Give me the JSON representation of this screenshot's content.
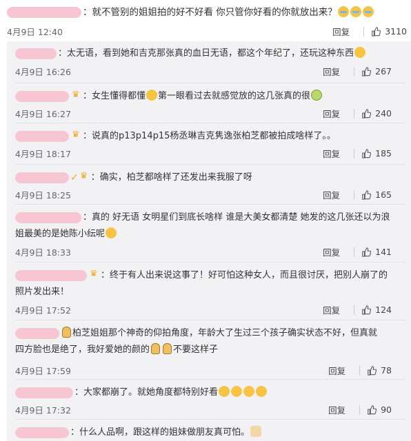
{
  "main": {
    "text": "：就不管别的姐姐拍的好不好看 你只管你好看的你就放出来？",
    "time": "4月9日 12:40",
    "reply": "回复",
    "likes": "3110"
  },
  "replies": [
    {
      "text": "：太无语，看到她和吉克那张真的血日无语，都这个年纪了，还玩这种东西",
      "time": "4月9日 16:26",
      "reply": "回复",
      "likes": "267"
    },
    {
      "text": "：女生懂得都懂",
      "text2": "第一眼看过去就感觉放的这几张真的很",
      "time": "4月9日 16:27",
      "reply": "回复",
      "likes": "240"
    },
    {
      "text": "：说真的p13p14p15杨丞琳吉克隽逸张柏芝都被拍成啥样了。。",
      "time": "4月9日 18:17",
      "reply": "回复",
      "likes": "185"
    },
    {
      "text": "：确实，柏芝都啥样了还发出来我服了呀",
      "time": "4月9日 18:25",
      "reply": "回复",
      "likes": "165"
    },
    {
      "text": "：真的 好无语 女明星们到底长啥样 谁是大美女都清楚 她发的这几张还以为浪",
      "text2": "姐最美的是她陈小纭呢",
      "time": "4月9日 18:33",
      "reply": "回复",
      "likes": "141"
    },
    {
      "text": "：终于有人出来说这事了！好可怕这种女人，而且很讨厌，把别人崩了的",
      "text2": "照片发出来！",
      "time": "4月9日 17:52",
      "reply": "回复",
      "likes": "124"
    },
    {
      "text": "柏芝姐姐那个神奇的仰拍角度，年龄大了生过三个孩子确实状态不好，但真就",
      "text2": "四方脸也是绝了，我好爱她的颜的",
      "text3": "不要这样子",
      "time": "4月9日 17:59",
      "reply": "回复",
      "likes": "78"
    },
    {
      "text": "：大家都崩了。就她角度都特别好看",
      "time": "4月9日 17:32",
      "reply": "回复",
      "likes": "90"
    },
    {
      "text": "：什么人品啊，跟这样的姐妹做朋友真可怕。"
    }
  ],
  "icons": {
    "like": "thumbs-up-icon",
    "verified": "vip-badge-icon"
  },
  "colors": {
    "name_pill": "#f7c6d3",
    "reply_bg": "#f2f2f5",
    "badge": "#f5a623"
  }
}
